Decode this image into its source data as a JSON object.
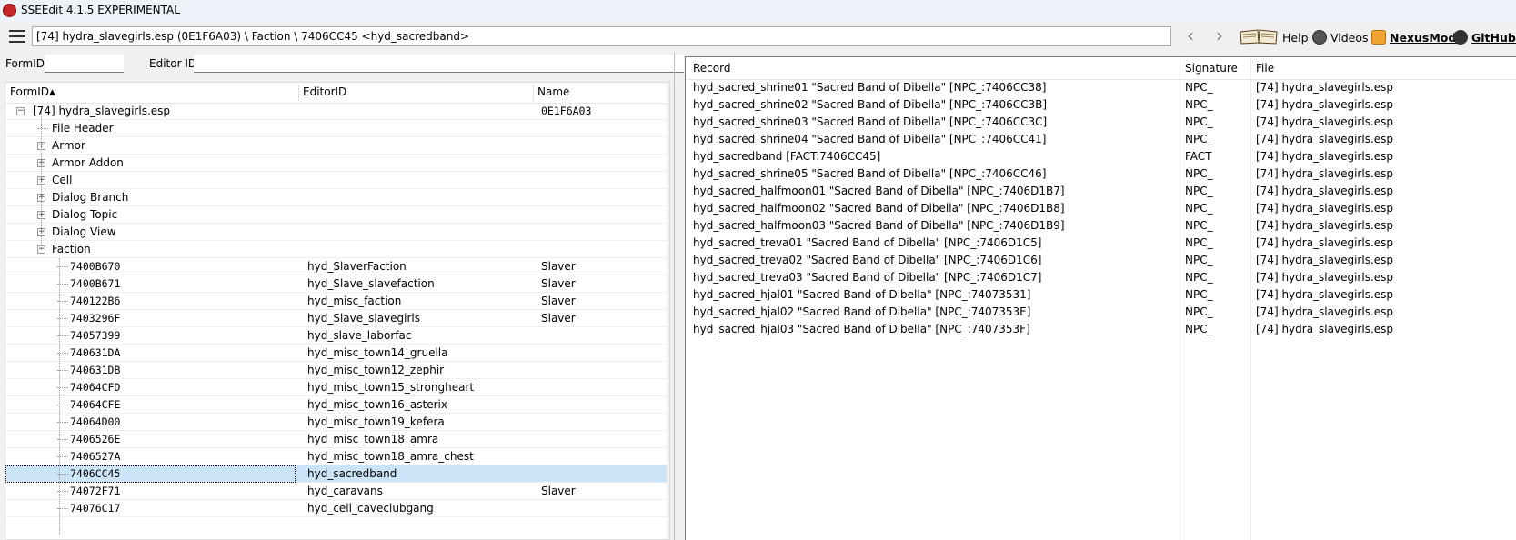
{
  "app": {
    "title": "SSEEdit 4.1.5 EXPERIMENTAL"
  },
  "toolbar": {
    "path": "[74] hydra_slavegirls.esp (0E1F6A03) \\ Faction \\ 7406CC45 <hyd_sacredband>",
    "back": "‹",
    "forward": "›",
    "help": "Help",
    "videos": "Videos",
    "nexusmods": "NexusMods",
    "github": "GitHub"
  },
  "filters": {
    "formid_label": "FormID",
    "editorid_label": "Editor ID",
    "formid_value": "",
    "editorid_value": ""
  },
  "tree": {
    "headers": {
      "formid": "FormID",
      "editorid": "EditorID",
      "name": "Name"
    },
    "plugin": {
      "label": "[74] hydra_slavegirls.esp",
      "id": "0E1F6A03"
    },
    "groups": [
      "File Header",
      "Armor",
      "Armor Addon",
      "Cell",
      "Dialog Branch",
      "Dialog Topic",
      "Dialog View",
      "Faction"
    ],
    "rows": [
      {
        "formid": "7400B670",
        "editorid": "hyd_SlaverFaction",
        "name": "Slaver"
      },
      {
        "formid": "7400B671",
        "editorid": "hyd_Slave_slavefaction",
        "name": "Slaver"
      },
      {
        "formid": "740122B6",
        "editorid": "hyd_misc_faction",
        "name": "Slaver"
      },
      {
        "formid": "7403296F",
        "editorid": "hyd_Slave_slavegirls",
        "name": "Slaver"
      },
      {
        "formid": "74057399",
        "editorid": "hyd_slave_laborfac",
        "name": ""
      },
      {
        "formid": "740631DA",
        "editorid": "hyd_misc_town14_gruella",
        "name": ""
      },
      {
        "formid": "740631DB",
        "editorid": "hyd_misc_town12_zephir",
        "name": ""
      },
      {
        "formid": "74064CFD",
        "editorid": "hyd_misc_town15_strongheart",
        "name": ""
      },
      {
        "formid": "74064CFE",
        "editorid": "hyd_misc_town16_asterix",
        "name": ""
      },
      {
        "formid": "74064D00",
        "editorid": "hyd_misc_town19_kefera",
        "name": ""
      },
      {
        "formid": "7406526E",
        "editorid": "hyd_misc_town18_amra",
        "name": ""
      },
      {
        "formid": "7406527A",
        "editorid": "hyd_misc_town18_amra_chest",
        "name": ""
      },
      {
        "formid": "7406CC45",
        "editorid": "hyd_sacredband",
        "name": ""
      },
      {
        "formid": "74072F71",
        "editorid": "hyd_caravans",
        "name": "Slaver"
      },
      {
        "formid": "74076C17",
        "editorid": "hyd_cell_caveclubgang",
        "name": ""
      }
    ]
  },
  "references": {
    "headers": {
      "record": "Record",
      "signature": "Signature",
      "file": "File"
    },
    "rows": [
      {
        "record": "hyd_sacred_shrine01 \"Sacred Band of Dibella\" [NPC_:7406CC38]",
        "signature": "NPC_",
        "file": "[74] hydra_slavegirls.esp"
      },
      {
        "record": "hyd_sacred_shrine02 \"Sacred Band of Dibella\" [NPC_:7406CC3B]",
        "signature": "NPC_",
        "file": "[74] hydra_slavegirls.esp"
      },
      {
        "record": "hyd_sacred_shrine03 \"Sacred Band of Dibella\" [NPC_:7406CC3C]",
        "signature": "NPC_",
        "file": "[74] hydra_slavegirls.esp"
      },
      {
        "record": "hyd_sacred_shrine04 \"Sacred Band of Dibella\" [NPC_:7406CC41]",
        "signature": "NPC_",
        "file": "[74] hydra_slavegirls.esp"
      },
      {
        "record": "hyd_sacredband [FACT:7406CC45]",
        "signature": "FACT",
        "file": "[74] hydra_slavegirls.esp"
      },
      {
        "record": "hyd_sacred_shrine05 \"Sacred Band of Dibella\" [NPC_:7406CC46]",
        "signature": "NPC_",
        "file": "[74] hydra_slavegirls.esp"
      },
      {
        "record": "hyd_sacred_halfmoon01 \"Sacred Band of Dibella\" [NPC_:7406D1B7]",
        "signature": "NPC_",
        "file": "[74] hydra_slavegirls.esp"
      },
      {
        "record": "hyd_sacred_halfmoon02 \"Sacred Band of Dibella\" [NPC_:7406D1B8]",
        "signature": "NPC_",
        "file": "[74] hydra_slavegirls.esp"
      },
      {
        "record": "hyd_sacred_halfmoon03 \"Sacred Band of Dibella\" [NPC_:7406D1B9]",
        "signature": "NPC_",
        "file": "[74] hydra_slavegirls.esp"
      },
      {
        "record": "hyd_sacred_treva01 \"Sacred Band of Dibella\" [NPC_:7406D1C5]",
        "signature": "NPC_",
        "file": "[74] hydra_slavegirls.esp"
      },
      {
        "record": "hyd_sacred_treva02 \"Sacred Band of Dibella\" [NPC_:7406D1C6]",
        "signature": "NPC_",
        "file": "[74] hydra_slavegirls.esp"
      },
      {
        "record": "hyd_sacred_treva03 \"Sacred Band of Dibella\" [NPC_:7406D1C7]",
        "signature": "NPC_",
        "file": "[74] hydra_slavegirls.esp"
      },
      {
        "record": "hyd_sacred_hjal01 \"Sacred Band of Dibella\" [NPC_:74073531]",
        "signature": "NPC_",
        "file": "[74] hydra_slavegirls.esp"
      },
      {
        "record": "hyd_sacred_hjal02 \"Sacred Band of Dibella\" [NPC_:7407353E]",
        "signature": "NPC_",
        "file": "[74] hydra_slavegirls.esp"
      },
      {
        "record": "hyd_sacred_hjal03 \"Sacred Band of Dibella\" [NPC_:7407353F]",
        "signature": "NPC_",
        "file": "[74] hydra_slavegirls.esp"
      }
    ]
  },
  "icons": {
    "app": "sseedit-icon",
    "menu": "hamburger-menu-icon",
    "help": "open-book-icon",
    "videos": "videos-icon",
    "nexus": "nexusmods-icon",
    "github": "github-icon"
  }
}
